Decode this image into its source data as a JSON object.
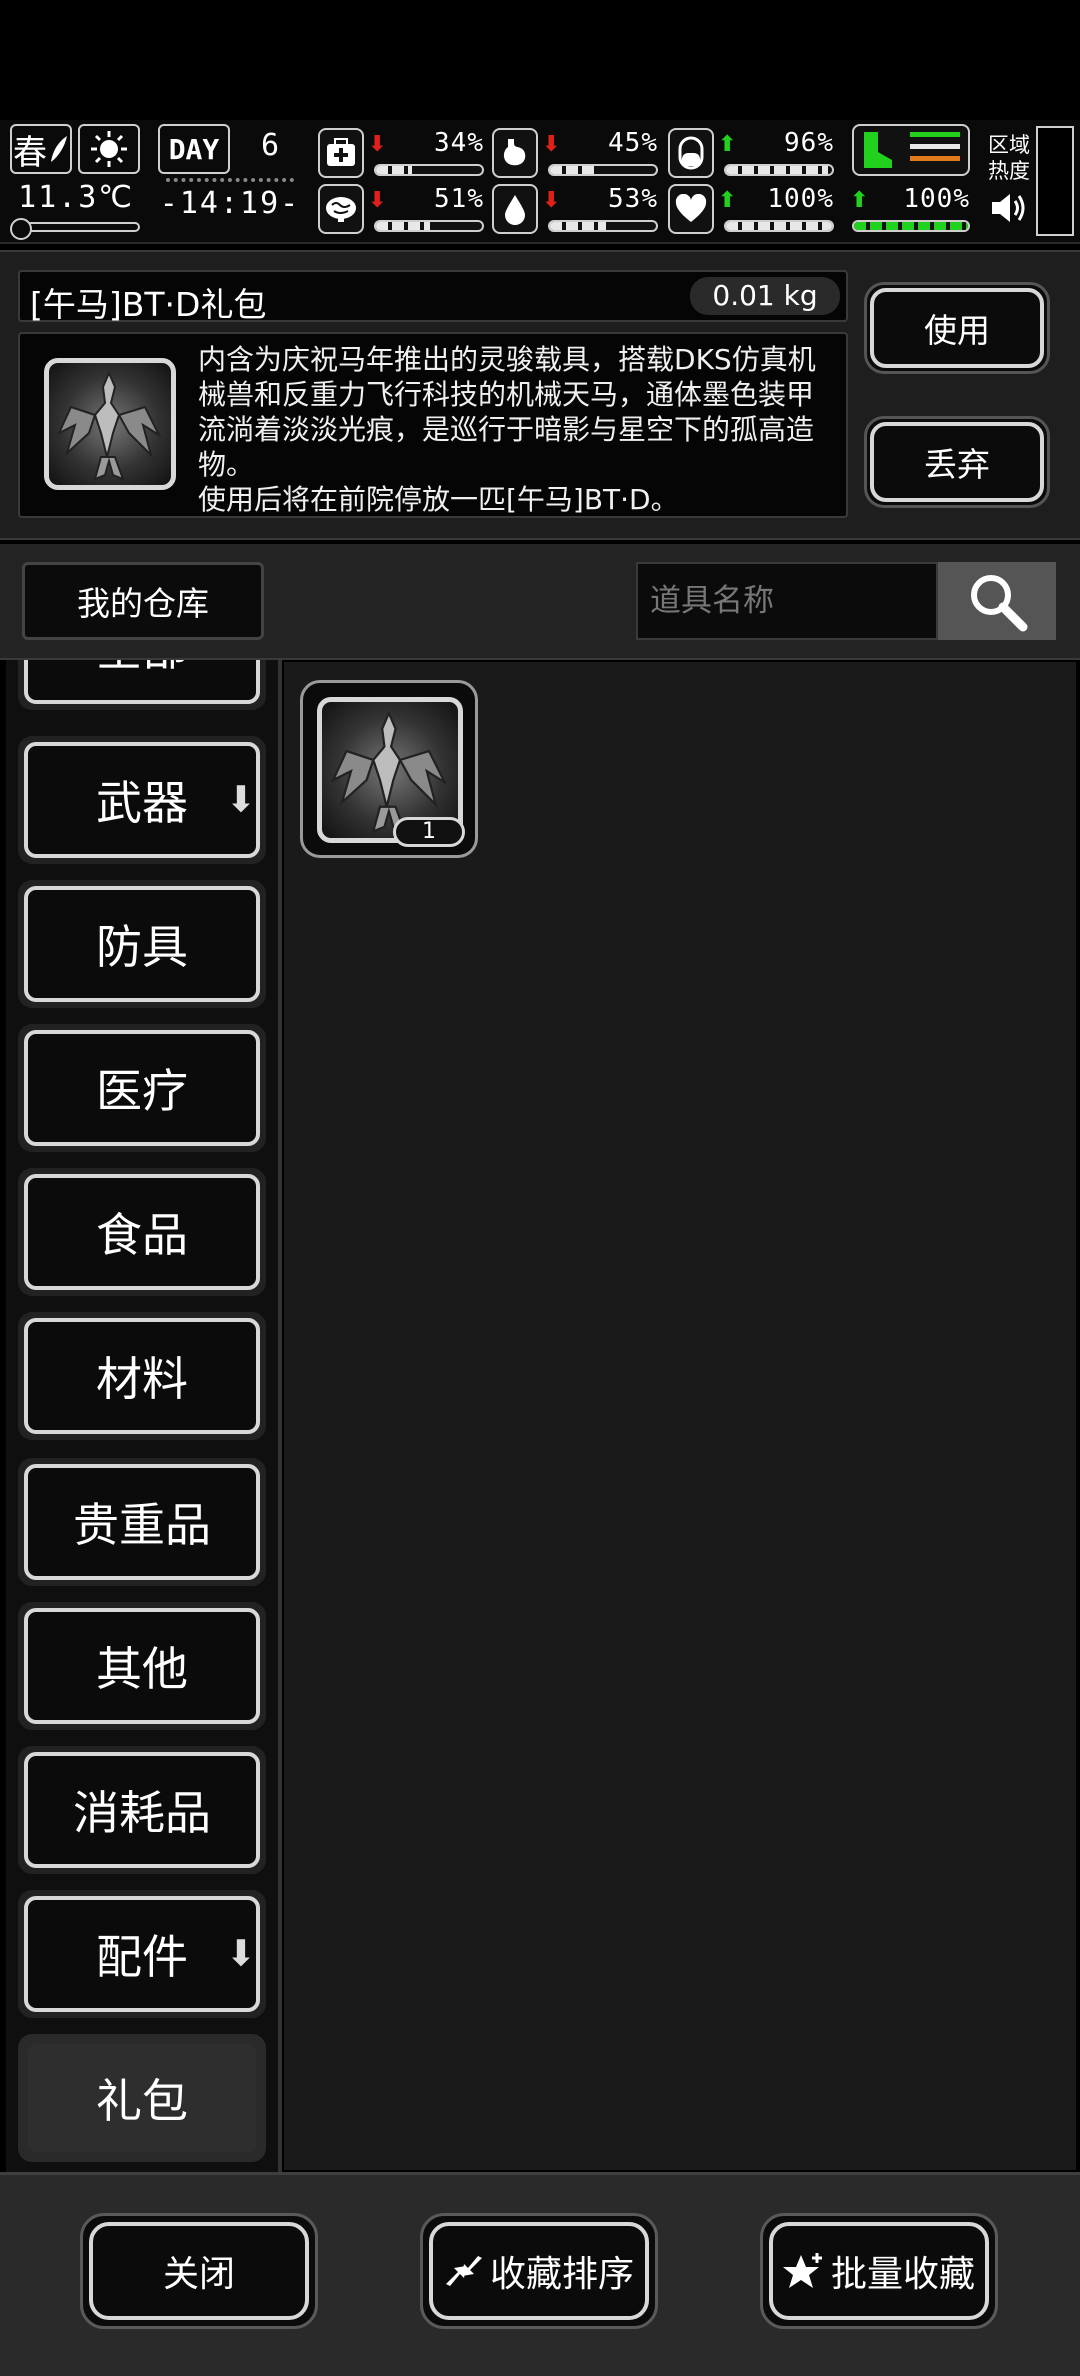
{
  "status": {
    "season": "春",
    "temperature": "11.3℃",
    "day_label": "DAY",
    "day_number": "6",
    "time": "-14:19-",
    "stats": [
      {
        "name": "health",
        "icon": "first-aid-icon",
        "trend": "down",
        "value": "34%",
        "level": 0.34
      },
      {
        "name": "hunger",
        "icon": "stomach-icon",
        "trend": "down",
        "value": "45%",
        "level": 0.45
      },
      {
        "name": "stamina",
        "icon": "capsule-icon",
        "trend": "up",
        "value": "96%",
        "level": 0.96
      },
      {
        "name": "mental",
        "icon": "brain-icon",
        "trend": "down",
        "value": "51%",
        "level": 0.51
      },
      {
        "name": "thirst",
        "icon": "water-drop-icon",
        "trend": "down",
        "value": "53%",
        "level": 0.53
      },
      {
        "name": "mood",
        "icon": "heart-icon",
        "trend": "up",
        "value": "100%",
        "level": 1.0
      },
      {
        "name": "endurance",
        "icon": "boot-icon",
        "trend": "up",
        "value": "100%",
        "level": 1.0
      }
    ],
    "region_heat": "区域\n热度"
  },
  "item": {
    "title": "[午马]BT·D礼包",
    "weight": "0.01 kg",
    "description": "内含为庆祝马年推出的灵骏载具，搭载DKS仿真机械兽和反重力飞行科技的机械天马，通体墨色装甲流淌着淡淡光痕，是巡行于暗影与星空下的孤高造物。\n使用后将在前院停放一匹[午马]BT·D。",
    "use_label": "使用",
    "discard_label": "丢弃"
  },
  "warehouse": {
    "title": "我的仓库",
    "search_placeholder": "道具名称"
  },
  "categories": [
    {
      "label": "全部",
      "has_arrow": false,
      "selected": false
    },
    {
      "label": "武器",
      "has_arrow": true,
      "selected": false
    },
    {
      "label": "防具",
      "has_arrow": false,
      "selected": false
    },
    {
      "label": "医疗",
      "has_arrow": false,
      "selected": false
    },
    {
      "label": "食品",
      "has_arrow": false,
      "selected": false
    },
    {
      "label": "材料",
      "has_arrow": false,
      "selected": false
    },
    {
      "label": "贵重品",
      "has_arrow": false,
      "selected": false
    },
    {
      "label": "其他",
      "has_arrow": false,
      "selected": false
    },
    {
      "label": "消耗品",
      "has_arrow": false,
      "selected": false
    },
    {
      "label": "配件",
      "has_arrow": true,
      "selected": false
    },
    {
      "label": "礼包",
      "has_arrow": false,
      "selected": true
    }
  ],
  "grid": {
    "items": [
      {
        "name": "[午马]BT·D礼包",
        "count": "1"
      }
    ]
  },
  "bottom": {
    "close_label": "关闭",
    "sort_label": "收藏排序",
    "batch_label": "批量收藏"
  },
  "colors": {
    "down": "#e0201a",
    "up": "#22d01e",
    "panel": "#1e1e1e",
    "border_light": "#d8d8d8"
  }
}
